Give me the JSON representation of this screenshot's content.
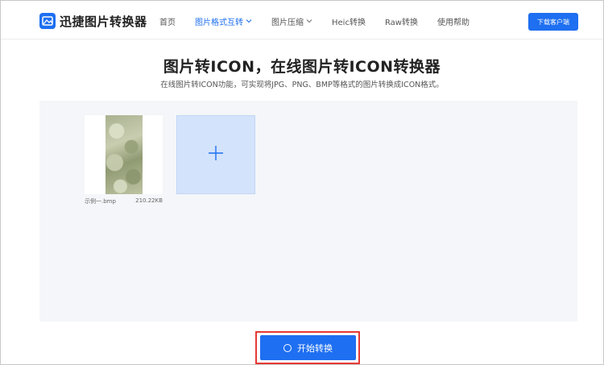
{
  "header": {
    "logo_text": "迅捷图片转换器",
    "nav": [
      {
        "label": "首页",
        "active": false,
        "has_caret": false
      },
      {
        "label": "图片格式互转",
        "active": true,
        "has_caret": true
      },
      {
        "label": "图片压缩",
        "active": false,
        "has_caret": true
      },
      {
        "label": "Heic转换",
        "active": false,
        "has_caret": false
      },
      {
        "label": "Raw转换",
        "active": false,
        "has_caret": false
      },
      {
        "label": "使用帮助",
        "active": false,
        "has_caret": false
      }
    ],
    "download_label": "下载客户端"
  },
  "main": {
    "title": "图片转ICON，在线图片转ICON转换器",
    "subtitle": "在线图片转ICON功能，可实现将JPG、PNG、BMP等格式的图片转换成ICON格式。"
  },
  "files": [
    {
      "name": "示例一.bmp",
      "size": "210.22KB"
    }
  ],
  "add_tile_icon": "plus-icon",
  "start_button": {
    "label": "开始转换",
    "icon": "circle-icon"
  },
  "colors": {
    "accent": "#1e6ff1",
    "highlight_outline": "#e53935",
    "add_tile_bg": "#d3e3fb",
    "upload_area_bg": "#f4f6f9"
  }
}
